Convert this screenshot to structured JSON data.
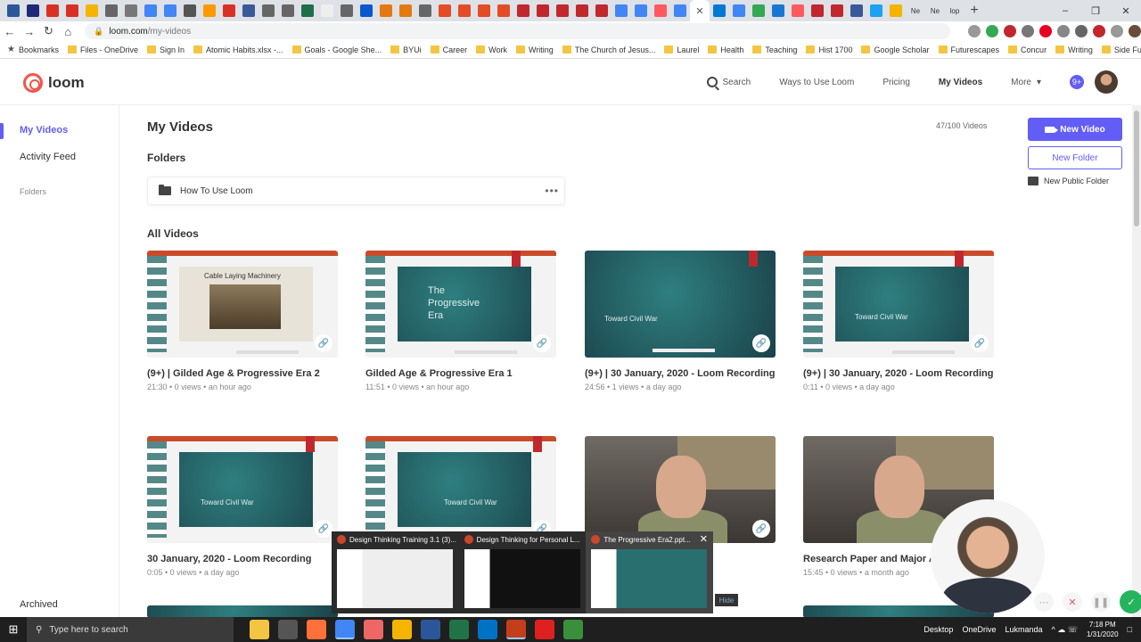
{
  "browser": {
    "url_domain": "loom.com",
    "url_path": "/my-videos",
    "bookmarks": [
      "Bookmarks",
      "Files - OneDrive",
      "Sign In",
      "Atomic Habits.xlsx -...",
      "Goals - Google She...",
      "BYUi",
      "Career",
      "Work",
      "Writing",
      "The Church of Jesus...",
      "Laurel",
      "Health",
      "Teaching",
      "Hist 1700",
      "Google Scholar",
      "Futurescapes",
      "Concur",
      "Writing",
      "Side Funds"
    ],
    "tab_colors": [
      "#2b579a",
      "#1e2a78",
      "#d93025",
      "#d93025",
      "#f4b400",
      "#666666",
      "#777777",
      "#4285f4",
      "#4285f4",
      "#555555",
      "#ff9900",
      "#d93025",
      "#3b5998",
      "#666666",
      "#666666",
      "#1e6e4a",
      "#eeeeee",
      "#666666",
      "#0b57d0",
      "#e47911",
      "#e47911",
      "#666666",
      "#e34c26",
      "#e34c26",
      "#e34c26",
      "#e34c26",
      "#c0282d",
      "#c0282d",
      "#c0282d",
      "#c0282d",
      "#c0282d",
      "#4285f4",
      "#4285f4",
      "#ff5a5f",
      "#4285f4"
    ],
    "tab_colors_after": [
      "#0078d4",
      "#4285f4",
      "#34a853",
      "#1976d2",
      "#ff5a5f",
      "#c0282d",
      "#c0282d",
      "#3b5998",
      "#1da1f2",
      "#f4b400",
      "#555555",
      "#aaaaaa",
      "#333333"
    ],
    "tab_labels_after": [
      "Ne",
      "Ne",
      "lop"
    ]
  },
  "loom": {
    "brand": "loom",
    "nav": {
      "search": "Search",
      "ways": "Ways to Use Loom",
      "pricing": "Pricing",
      "my_videos": "My Videos",
      "more": "More"
    },
    "sidebar": {
      "my_videos": "My Videos",
      "activity": "Activity Feed",
      "folders": "Folders",
      "archived": "Archived"
    },
    "page_title": "My Videos",
    "video_count": "47/100 Videos",
    "folders_heading": "Folders",
    "folder_name": "How To Use Loom",
    "all_videos_heading": "All Videos",
    "actions": {
      "new_video": "New Video",
      "new_folder": "New Folder",
      "new_public_folder": "New Public Folder"
    },
    "videos": [
      {
        "title": "(9+) | Gilded Age & Progressive Era 2",
        "meta": "21:30 • 0 views • an hour ago",
        "slide_text": "Cable Laying Machinery"
      },
      {
        "title": "Gilded Age & Progressive Era 1",
        "meta": "11:51 • 0 views • an hour ago",
        "slide_text": "The Progressive Era"
      },
      {
        "title": "(9+) | 30 January, 2020 - Loom Recording",
        "meta": "24:56 • 1 views • a day ago",
        "slide_text": "Toward Civil War"
      },
      {
        "title": "(9+) | 30 January, 2020 - Loom Recording",
        "meta": "0:11 • 0 views • a day ago",
        "slide_text": "Toward Civil War"
      },
      {
        "title": "30 January, 2020 - Loom Recording",
        "meta": "0:05 • 0 views • a day ago",
        "slide_text": "Toward Civil War"
      },
      {
        "title": "",
        "meta": "",
        "slide_text": "Toward Civil War"
      },
      {
        "title": "",
        "meta": "",
        "slide_text": ""
      },
      {
        "title": "Research Paper and Major A",
        "meta": "15:45 • 0 views • a month ago",
        "slide_text": ""
      }
    ],
    "accent": "#625df5"
  },
  "taskbar_preview": {
    "items": [
      "Design Thinking Training 3.1 (3)...",
      "Design Thinking for Personal L...",
      "The Progressive Era2.ppt..."
    ],
    "hide_label": "Hide"
  },
  "taskbar": {
    "search_placeholder": "Type here to search",
    "desktop": "Desktop",
    "onedrive": "OneDrive",
    "user": "Lukmanda",
    "time": "7:18 PM",
    "date": "1/31/2020"
  }
}
